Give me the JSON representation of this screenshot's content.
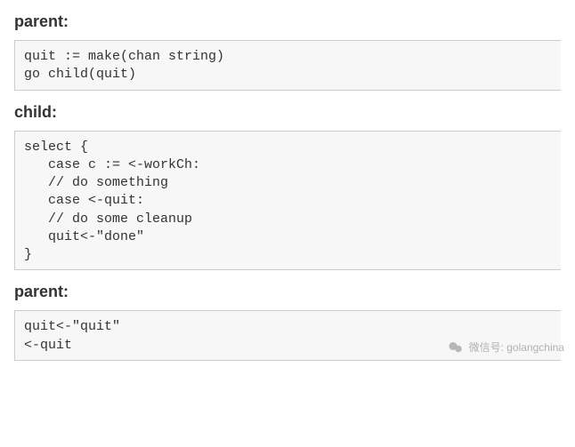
{
  "sections": [
    {
      "heading": "parent:",
      "code": "quit := make(chan string)\ngo child(quit)"
    },
    {
      "heading": "child:",
      "code": "select {\n   case c := <-workCh:\n   // do something\n   case <-quit:\n   // do some cleanup\n   quit<-\"done\"\n}"
    },
    {
      "heading": "parent:",
      "code": "quit<-\"quit\"\n<-quit"
    }
  ],
  "watermark": {
    "label": "微信号: golangchina"
  }
}
